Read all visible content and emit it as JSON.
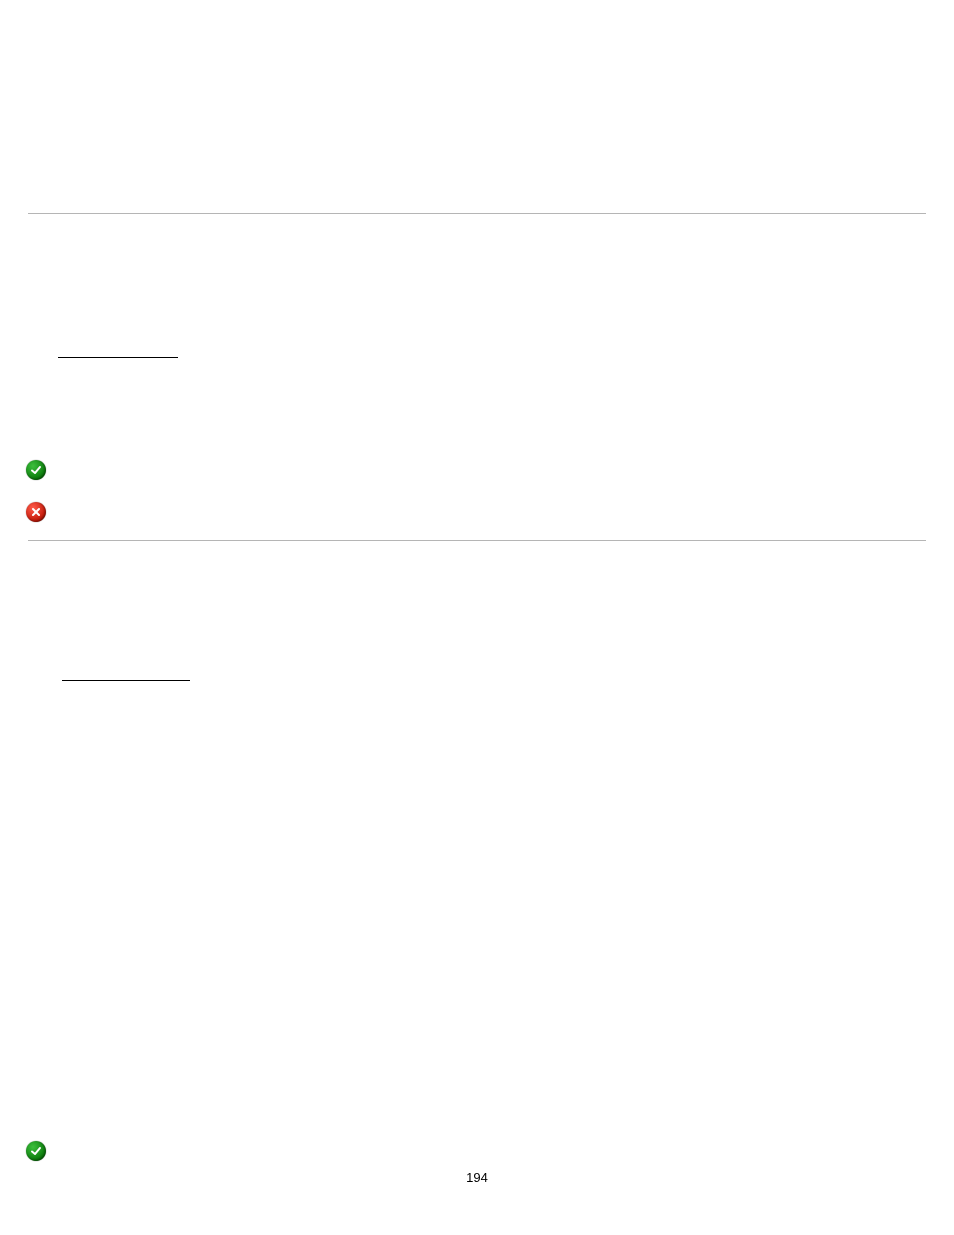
{
  "page_number": "194"
}
